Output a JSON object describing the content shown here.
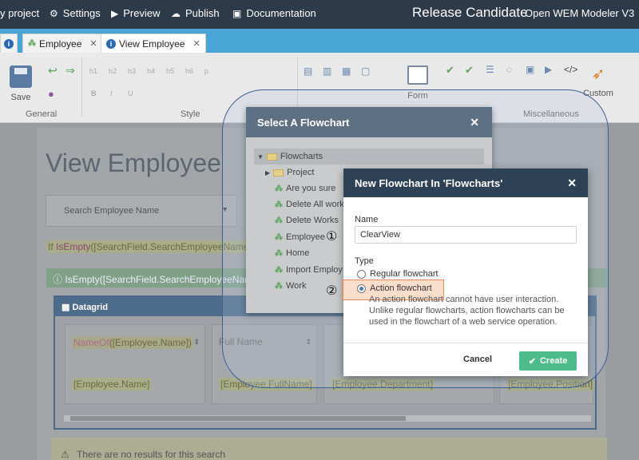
{
  "topbar": {
    "project": "y project",
    "settings": "Settings",
    "preview": "Preview",
    "publish": "Publish",
    "documentation": "Documentation",
    "brand": "Release Candidate",
    "product": "Open WEM Modeler V3"
  },
  "tabs": [
    {
      "label": "Employee",
      "active": false
    },
    {
      "label": "View Employee",
      "active": true
    }
  ],
  "ribbon": {
    "save": "Save",
    "general": "General",
    "style": "Style",
    "form": "Form",
    "custom": "Custom",
    "miscellaneous": "Miscellaneous",
    "headings": [
      "h1",
      "h2",
      "h3",
      "h4",
      "h5",
      "h6",
      "p"
    ]
  },
  "page": {
    "title": "View Employee",
    "search_placeholder": "Search Employee Name",
    "if_prefix": "If",
    "if_fn": "IsEmpty",
    "if_arg": "([SearchField.SearchEmployeeName])",
    "condition": "IsEmpty([SearchField.SearchEmployeeName])",
    "datagrid": "Datagrid",
    "columns": [
      {
        "header_fn": "NameOf",
        "header": "([Employee.Name])",
        "cell": "[Employee.Name]"
      },
      {
        "header": "Full Name",
        "cell": "[Employee.FullName]"
      },
      {
        "header": "",
        "cell": "[Employee.Department]"
      },
      {
        "header": "",
        "cell": "[Employee.Position]"
      }
    ],
    "no_results": "There are no results for this search"
  },
  "select_dialog": {
    "title": "Select A Flowchart",
    "root": "Flowcharts",
    "items": [
      "Project",
      "Are you sure",
      "Delete All work",
      "Delete Works",
      "Employee",
      "Home",
      "Import Employ",
      "Work"
    ]
  },
  "markers": {
    "one": "①",
    "two": "②"
  },
  "new_dialog": {
    "title": "New Flowchart In 'Flowcharts'",
    "name_label": "Name",
    "name_value": "ClearView",
    "type_label": "Type",
    "regular": "Regular flowchart",
    "action": "Action flowchart",
    "description": "An action flowchart cannot have user interaction. Unlike regular flowcharts, action flowcharts can be used in the flowchart of a web service operation.",
    "cancel": "Cancel",
    "create": "Create"
  }
}
